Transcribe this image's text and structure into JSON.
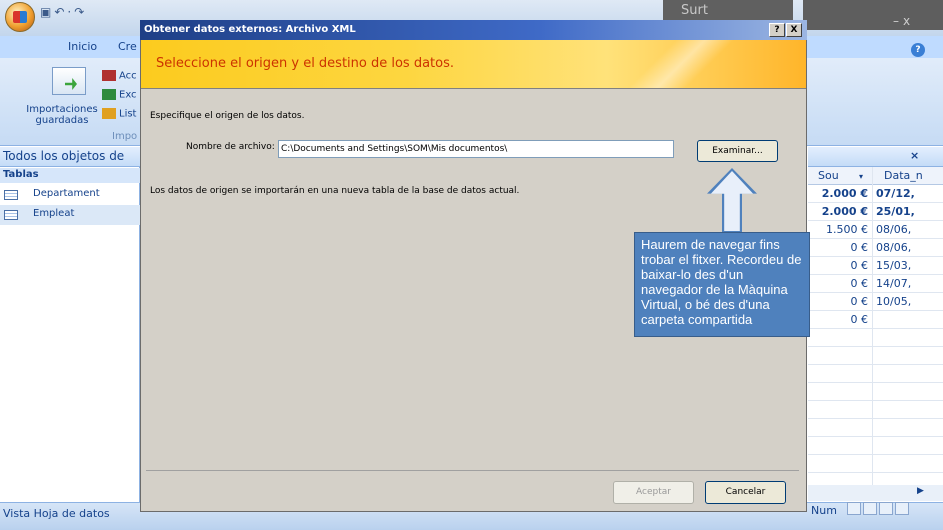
{
  "app": {
    "tabs": [
      "Inicio",
      "Cre"
    ],
    "ribbon": {
      "saved_imports": "Importaciones guardadas",
      "small_buttons": [
        "Acc",
        "Exc",
        "List"
      ],
      "group_label": "Impo"
    },
    "nav": {
      "header": "Todos los objetos de",
      "group": "Tablas",
      "items": [
        "Departament",
        "Empleat"
      ]
    },
    "grid": {
      "close": "×",
      "columns": [
        "Sou",
        "Data_n"
      ],
      "rows": [
        [
          "2.000 €",
          "07/12,"
        ],
        [
          "2.000 €",
          "25/01,"
        ],
        [
          "1.500 €",
          "08/06,"
        ],
        [
          "0 €",
          "08/06,"
        ],
        [
          "0 €",
          "15/03,"
        ],
        [
          "0 €",
          "14/07,"
        ],
        [
          "0 €",
          "10/05,"
        ],
        [
          "0 €",
          ""
        ]
      ]
    },
    "status": {
      "left": "Vista Hoja de datos",
      "num": "Num"
    },
    "overlay_title": "Surt"
  },
  "dialog": {
    "title": "Obtener datos externos: Archivo XML",
    "help_btn": "?",
    "close_btn": "X",
    "banner": "Seleccione el origen y el destino de los datos.",
    "specify": "Especifique el origen de los datos.",
    "filename_label": "Nombre de archivo:",
    "filename_value": "C:\\Documents and Settings\\SOM\\Mis documentos\\",
    "browse": "Examinar...",
    "note": "Los datos de origen se importarán en una nueva tabla de la base de datos actual.",
    "accept": "Aceptar",
    "cancel": "Cancelar"
  },
  "annotation": {
    "callout": "Haurem de navegar fins trobar el fitxer. Recordeu de baixar-lo des d'un navegador de la Màquina Virtual, o bé des d'una carpeta compartida",
    "color": "#4f81bd"
  }
}
